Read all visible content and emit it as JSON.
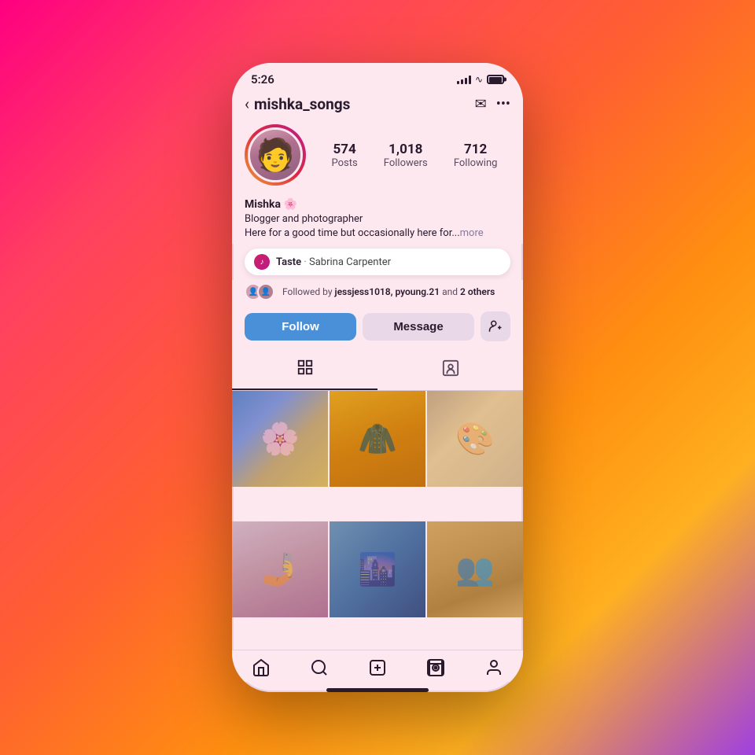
{
  "background": {
    "gradient": "linear-gradient(135deg, #ff0080, #ff4060, #ff6030, #ff9010, #a040e0)"
  },
  "status_bar": {
    "time": "5:26",
    "signal_label": "signal",
    "wifi_label": "wifi",
    "battery_label": "battery"
  },
  "header": {
    "back_label": "‹",
    "username": "mishka_songs",
    "send_icon": "send",
    "more_icon": "more"
  },
  "profile": {
    "avatar_alt": "Mishka profile photo",
    "stats": {
      "posts_count": "574",
      "posts_label": "Posts",
      "followers_count": "1,018",
      "followers_label": "Followers",
      "following_count": "712",
      "following_label": "Following"
    },
    "name": "Mishka 🌸",
    "bio_line1": "Blogger and photographer",
    "bio_line2": "Here for a good time but occasionally here for...",
    "bio_more": "more"
  },
  "music": {
    "icon": "♪",
    "song": "Taste",
    "dot": "·",
    "artist": "Sabrina Carpenter"
  },
  "followed_by": {
    "text": "Followed by ",
    "names": "jessjess1018, pyoung.21",
    "suffix": " and ",
    "others": "2 others"
  },
  "actions": {
    "follow_label": "Follow",
    "message_label": "Message",
    "add_person_icon": "👤+"
  },
  "tabs": {
    "grid_icon": "⊞",
    "tagged_icon": "👤"
  },
  "photos": [
    {
      "id": "photo-1",
      "class": "photo-1",
      "alt": "Floral pattern with food"
    },
    {
      "id": "photo-2",
      "class": "photo-2",
      "alt": "Person in yellow raincoat"
    },
    {
      "id": "photo-3",
      "class": "photo-3",
      "alt": "Wall mural art"
    },
    {
      "id": "photo-4",
      "class": "photo-4",
      "alt": "Selfie photo"
    },
    {
      "id": "photo-5",
      "class": "photo-5",
      "alt": "Road perspective"
    },
    {
      "id": "photo-6",
      "class": "photo-6",
      "alt": "Group colorful photo"
    }
  ],
  "bottom_nav": {
    "home_icon": "🏠",
    "search_icon": "🔍",
    "create_icon": "➕",
    "reels_icon": "▶",
    "profile_icon": "👤"
  }
}
